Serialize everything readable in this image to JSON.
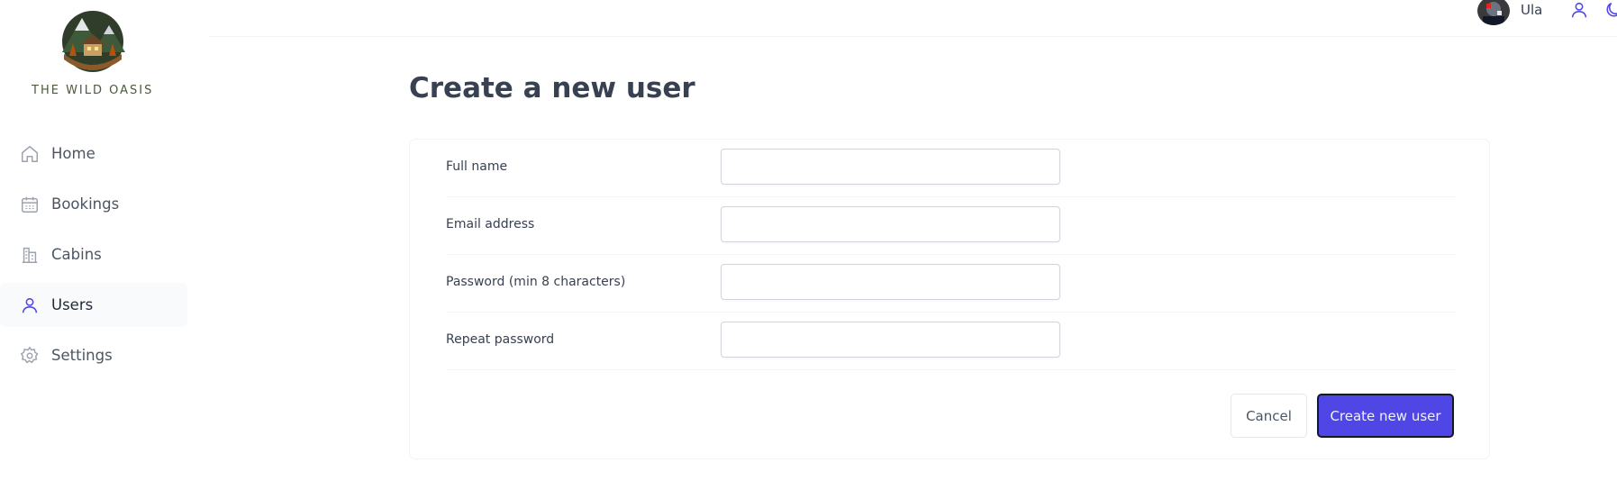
{
  "brand": {
    "name": "THE WILD OASIS"
  },
  "sidebar": {
    "items": [
      {
        "label": "Home",
        "icon": "home-icon",
        "active": false
      },
      {
        "label": "Bookings",
        "icon": "calendar-icon",
        "active": false
      },
      {
        "label": "Cabins",
        "icon": "building-icon",
        "active": false
      },
      {
        "label": "Users",
        "icon": "user-icon",
        "active": true
      },
      {
        "label": "Settings",
        "icon": "gear-icon",
        "active": false
      }
    ]
  },
  "header": {
    "username": "Ula",
    "icons": [
      "account-icon",
      "dark-mode-icon"
    ]
  },
  "main": {
    "title": "Create a new user",
    "form": {
      "fields": [
        {
          "label": "Full name",
          "value": ""
        },
        {
          "label": "Email address",
          "value": ""
        },
        {
          "label": "Password (min 8 characters)",
          "value": ""
        },
        {
          "label": "Repeat password",
          "value": ""
        }
      ],
      "cancel_label": "Cancel",
      "submit_label": "Create new user"
    }
  },
  "colors": {
    "accent": "#4f46e5",
    "active_icon": "#4f46e5",
    "icon": "#9ca3af"
  }
}
